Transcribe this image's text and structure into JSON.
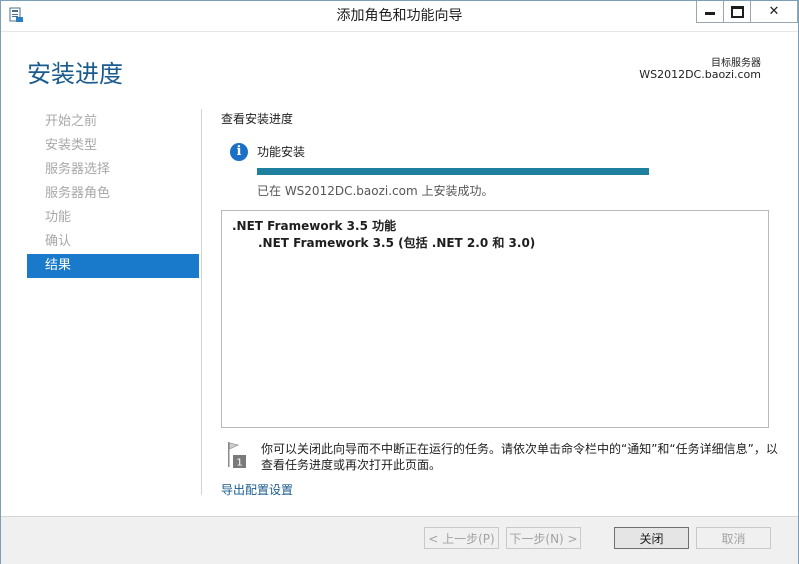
{
  "window": {
    "title": "添加角色和功能向导",
    "minimize_glyph": "",
    "close_glyph": "✕"
  },
  "header": {
    "page_title": "安装进度",
    "dest_label": "目标服务器",
    "dest_server": "WS2012DC.baozi.com"
  },
  "sidebar": {
    "steps": [
      {
        "label": "开始之前"
      },
      {
        "label": "安装类型"
      },
      {
        "label": "服务器选择"
      },
      {
        "label": "服务器角色"
      },
      {
        "label": "功能"
      },
      {
        "label": "确认"
      },
      {
        "label": "结果"
      }
    ],
    "active_index": 6
  },
  "main": {
    "section_heading": "查看安装进度",
    "info_glyph": "i",
    "feature_label": "功能安装",
    "progress": 1.0,
    "success_text": "已在 WS2012DC.baozi.com 上安装成功。",
    "results": [
      ".NET Framework 3.5 功能",
      ".NET Framework 3.5 (包括 .NET 2.0 和 3.0)"
    ],
    "note": "你可以关闭此向导而不中断正在运行的任务。请依次单击命令栏中的“通知”和“任务详细信息”，以查看任务进度或再次打开此页面。",
    "export_link": "导出配置设置"
  },
  "footer": {
    "prev_label": "< 上一步(P)",
    "next_label": "下一步(N) >",
    "close_label": "关闭",
    "cancel_label": "取消"
  },
  "colors": {
    "accent": "#1979ca",
    "title_blue": "#1a5c8e",
    "progress": "#1f7f9e"
  },
  "icons": {
    "app": "server-manager-icon",
    "info": "info-icon",
    "flag": "flag-icon"
  }
}
